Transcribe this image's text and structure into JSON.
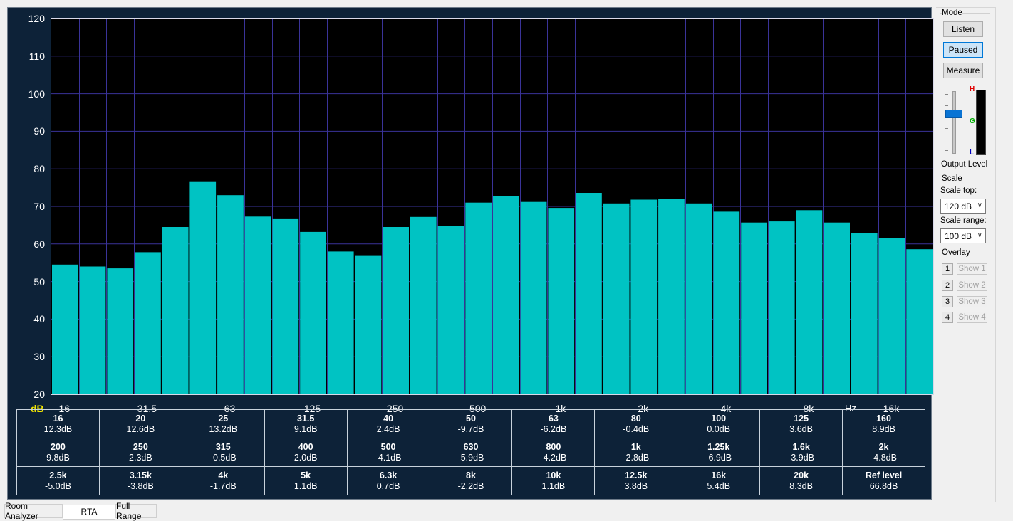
{
  "plot": {
    "y_ticks": [
      "120",
      "110",
      "100",
      "90",
      "80",
      "70",
      "60",
      "50",
      "40",
      "30",
      "20"
    ],
    "x_ticks": [
      "16",
      "31.5",
      "63",
      "125",
      "250",
      "500",
      "1k",
      "2k",
      "4k",
      "8k",
      "16k"
    ],
    "y_unit": "dB",
    "x_unit": "Hz",
    "colors": {
      "bar": "#00c3c3",
      "grid": "#3a3399",
      "background": "#000000"
    }
  },
  "chart_data": {
    "type": "bar",
    "ylim": [
      20,
      120
    ],
    "x_scale": "log (1/3 octave)",
    "grid": true,
    "categories": [
      "16",
      "20",
      "25",
      "31.5",
      "40",
      "50",
      "63",
      "80",
      "100",
      "125",
      "160",
      "200",
      "250",
      "315",
      "400",
      "500",
      "630",
      "800",
      "1k",
      "1.25k",
      "1.6k",
      "2k",
      "2.5k",
      "3.15k",
      "4k",
      "5k",
      "6.3k",
      "8k",
      "10k",
      "12.5k",
      "16k",
      "20k"
    ],
    "values": [
      54.5,
      54,
      53.5,
      57.8,
      64.5,
      76.5,
      73,
      67.3,
      66.8,
      63.2,
      58,
      57,
      64.5,
      67.2,
      64.8,
      71,
      72.7,
      71.2,
      69.6,
      73.6,
      70.8,
      71.8,
      72,
      70.8,
      68.6,
      65.7,
      66,
      69,
      65.7,
      63,
      61.5,
      58.6
    ]
  },
  "readout": {
    "rows": [
      [
        [
          "16",
          "12.3dB"
        ],
        [
          "20",
          "12.6dB"
        ],
        [
          "25",
          "13.2dB"
        ],
        [
          "31.5",
          "9.1dB"
        ],
        [
          "40",
          "2.4dB"
        ],
        [
          "50",
          "-9.7dB"
        ],
        [
          "63",
          "-6.2dB"
        ],
        [
          "80",
          "-0.4dB"
        ],
        [
          "100",
          "0.0dB"
        ],
        [
          "125",
          "3.6dB"
        ],
        [
          "160",
          "8.9dB"
        ]
      ],
      [
        [
          "200",
          "9.8dB"
        ],
        [
          "250",
          "2.3dB"
        ],
        [
          "315",
          "-0.5dB"
        ],
        [
          "400",
          "2.0dB"
        ],
        [
          "500",
          "-4.1dB"
        ],
        [
          "630",
          "-5.9dB"
        ],
        [
          "800",
          "-4.2dB"
        ],
        [
          "1k",
          "-2.8dB"
        ],
        [
          "1.25k",
          "-6.9dB"
        ],
        [
          "1.6k",
          "-3.9dB"
        ],
        [
          "2k",
          "-4.8dB"
        ]
      ],
      [
        [
          "2.5k",
          "-5.0dB"
        ],
        [
          "3.15k",
          "-3.8dB"
        ],
        [
          "4k",
          "-1.7dB"
        ],
        [
          "5k",
          "1.1dB"
        ],
        [
          "6.3k",
          "0.7dB"
        ],
        [
          "8k",
          "-2.2dB"
        ],
        [
          "10k",
          "1.1dB"
        ],
        [
          "12.5k",
          "3.8dB"
        ],
        [
          "16k",
          "5.4dB"
        ],
        [
          "20k",
          "8.3dB"
        ],
        [
          "Ref level",
          "66.8dB"
        ]
      ]
    ]
  },
  "side": {
    "mode_title": "Mode",
    "listen": "Listen",
    "paused": "Paused",
    "measure": "Measure",
    "meter_h": "H",
    "meter_g": "G",
    "meter_l": "L",
    "output_level": "Output Level",
    "scale_title": "Scale",
    "scale_top_label": "Scale top:",
    "scale_top_value": "120 dB",
    "scale_range_label": "Scale range:",
    "scale_range_value": "100 dB",
    "overlay_title": "Overlay",
    "overlays": [
      {
        "num": "1",
        "label": "Show 1"
      },
      {
        "num": "2",
        "label": "Show 2"
      },
      {
        "num": "3",
        "label": "Show 3"
      },
      {
        "num": "4",
        "label": "Show 4"
      }
    ]
  },
  "tabs": [
    "Room Analyzer",
    "RTA",
    "Full Range"
  ]
}
